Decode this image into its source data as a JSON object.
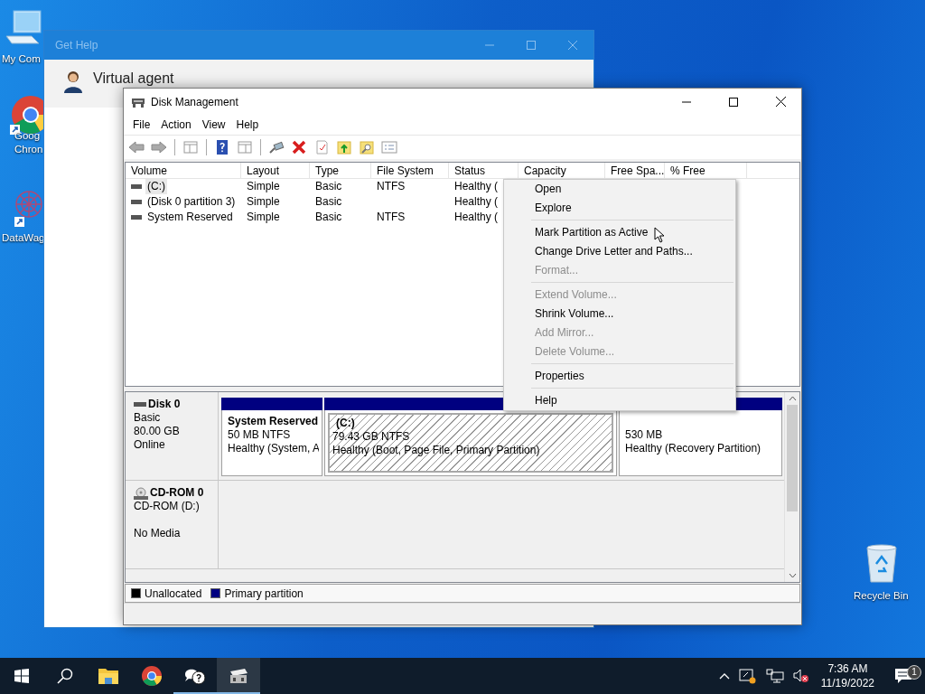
{
  "desktop_icons": [
    {
      "kind": "computer",
      "lines": [
        "My Com"
      ]
    },
    {
      "kind": "chrome",
      "lines": [
        "Goog",
        "Chron"
      ]
    },
    {
      "kind": "network",
      "lines": [
        "DataWag"
      ]
    },
    {
      "kind": "recycle",
      "lines": [
        "Recycle Bin"
      ]
    }
  ],
  "get_help": {
    "title": "Get Help",
    "agent": "Virtual agent"
  },
  "disk_management": {
    "title": "Disk Management",
    "menu": [
      "File",
      "Action",
      "View",
      "Help"
    ],
    "columns": [
      "Volume",
      "Layout",
      "Type",
      "File System",
      "Status",
      "Capacity",
      "Free Spa...",
      "% Free"
    ],
    "rows": [
      {
        "volume": "(C:)",
        "selected": true,
        "layout": "Simple",
        "type": "Basic",
        "file_system": "NTFS",
        "status": "Healthy ("
      },
      {
        "volume": "(Disk 0 partition 3)",
        "selected": false,
        "layout": "Simple",
        "type": "Basic",
        "status": "Healthy ("
      },
      {
        "volume": "System Reserved",
        "selected": false,
        "layout": "Simple",
        "type": "Basic",
        "file_system": "NTFS",
        "status": "Healthy ("
      }
    ],
    "disks": [
      {
        "kind": "disk",
        "name": "Disk 0",
        "details": [
          "Basic",
          "80.00 GB"
        ],
        "status": "Online",
        "partitions": [
          {
            "name": "System Reserved",
            "size": "50 MB NTFS",
            "status": "Healthy (System, A",
            "selected": false
          },
          {
            "name": "(C:)",
            "size": "79.43 GB NTFS",
            "status": "Healthy (Boot, Page File, Primary Partition)",
            "selected": true
          },
          {
            "size": "530 MB",
            "status": "Healthy (Recovery Partition)",
            "selected": false
          }
        ]
      },
      {
        "kind": "cdrom",
        "name": "CD-ROM 0",
        "details": [
          "CD-ROM (D:)"
        ],
        "status": "No Media"
      }
    ],
    "legend": [
      {
        "label": "Unallocated",
        "color": "#000000"
      },
      {
        "label": "Primary partition",
        "color": "#000080"
      }
    ]
  },
  "context_menu": [
    {
      "kind": "item",
      "label": "Open",
      "disabled": false
    },
    {
      "kind": "item",
      "label": "Explore",
      "disabled": false
    },
    {
      "kind": "separator"
    },
    {
      "kind": "item",
      "label": "Mark Partition as Active",
      "disabled": false
    },
    {
      "kind": "item",
      "label": "Change Drive Letter and Paths...",
      "disabled": false
    },
    {
      "kind": "item",
      "label": "Format...",
      "disabled": true
    },
    {
      "kind": "separator"
    },
    {
      "kind": "item",
      "label": "Extend Volume...",
      "disabled": true
    },
    {
      "kind": "item",
      "label": "Shrink Volume...",
      "disabled": false
    },
    {
      "kind": "item",
      "label": "Add Mirror...",
      "disabled": true
    },
    {
      "kind": "item",
      "label": "Delete Volume...",
      "disabled": true
    },
    {
      "kind": "separator"
    },
    {
      "kind": "item",
      "label": "Properties",
      "disabled": false
    },
    {
      "kind": "separator"
    },
    {
      "kind": "item",
      "label": "Help",
      "disabled": false
    }
  ],
  "taskbar": {
    "apps": [
      {
        "kind": "start",
        "running": false,
        "selected": false
      },
      {
        "kind": "search",
        "running": false,
        "selected": false
      },
      {
        "kind": "explorer",
        "running": false,
        "selected": false
      },
      {
        "kind": "chrome",
        "running": false,
        "selected": false
      },
      {
        "kind": "gethelp",
        "running": true,
        "selected": false
      },
      {
        "kind": "diskmgmt",
        "running": true,
        "selected": true
      }
    ],
    "tray": {
      "time": "7:36 AM",
      "date": "11/19/2022",
      "notifications": "1"
    }
  }
}
